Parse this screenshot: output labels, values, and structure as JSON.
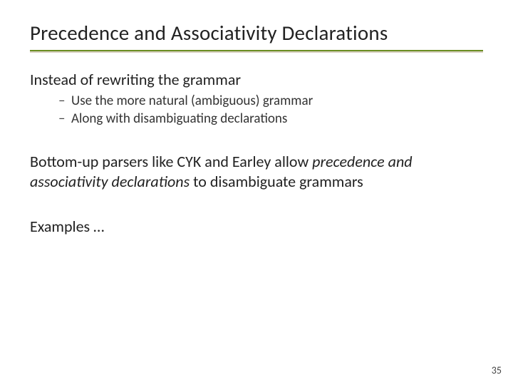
{
  "title": "Precedence and Associativity Declarations",
  "lead": "Instead of rewriting the grammar",
  "bullets": [
    "Use the more natural (ambiguous) grammar",
    "Along with disambiguating declarations"
  ],
  "para2_pre": "Bottom-up parsers like CYK and Earley allow ",
  "para2_em": "precedence and associativity declarations",
  "para2_post": " to disambiguate grammars",
  "para3": "Examples …",
  "page_number": "35"
}
